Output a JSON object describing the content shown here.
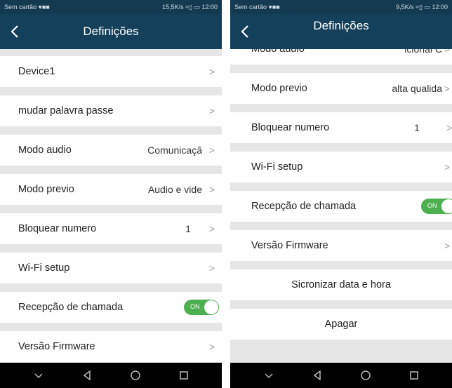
{
  "left": {
    "status": {
      "left_text": "Sem cartão ♥■■",
      "right_text": "15,5K/s ≈▯ ▭ 12:00"
    },
    "title": "Definições",
    "rows": [
      {
        "label": "Device1",
        "value": ""
      },
      {
        "label": "mudar palavra passe",
        "value": ""
      },
      {
        "label": "Modo audio",
        "value": "Comunicaçã"
      },
      {
        "label": "Modo previo",
        "value": "Audio e vide"
      },
      {
        "label": "Bloquear numero",
        "value": "1"
      },
      {
        "label": "Wi-Fi setup",
        "value": ""
      },
      {
        "label": "Recepção de chamada",
        "toggle": "ON"
      },
      {
        "label": "Versão Firmware",
        "value": ""
      }
    ]
  },
  "right": {
    "status": {
      "left_text": "Sem cartão ♥■■",
      "right_text": "9,5K/s ≈▯ ▭ 12:00"
    },
    "title": "Definições",
    "rows": [
      {
        "label": "Modo audio",
        "value": "icional   C"
      },
      {
        "label": "Modo previo",
        "value": "alta qualida"
      },
      {
        "label": "Bloquear numero",
        "value": "1"
      },
      {
        "label": "Wi-Fi setup",
        "value": ""
      },
      {
        "label": "Recepção de chamada",
        "toggle": "ON"
      },
      {
        "label": "Versão Firmware",
        "value": ""
      },
      {
        "label": "Sicronizar data e hora"
      },
      {
        "label": "Apagar"
      }
    ]
  },
  "colors": {
    "appbar": "#15405b",
    "statusbar": "#143a52",
    "toggle_on": "#4caf50",
    "background": "#e6e6e6"
  },
  "icons": [
    "back-arrow-icon",
    "chevron-right-icon",
    "nav-down-icon",
    "nav-back-icon",
    "nav-home-icon",
    "nav-recents-icon"
  ]
}
